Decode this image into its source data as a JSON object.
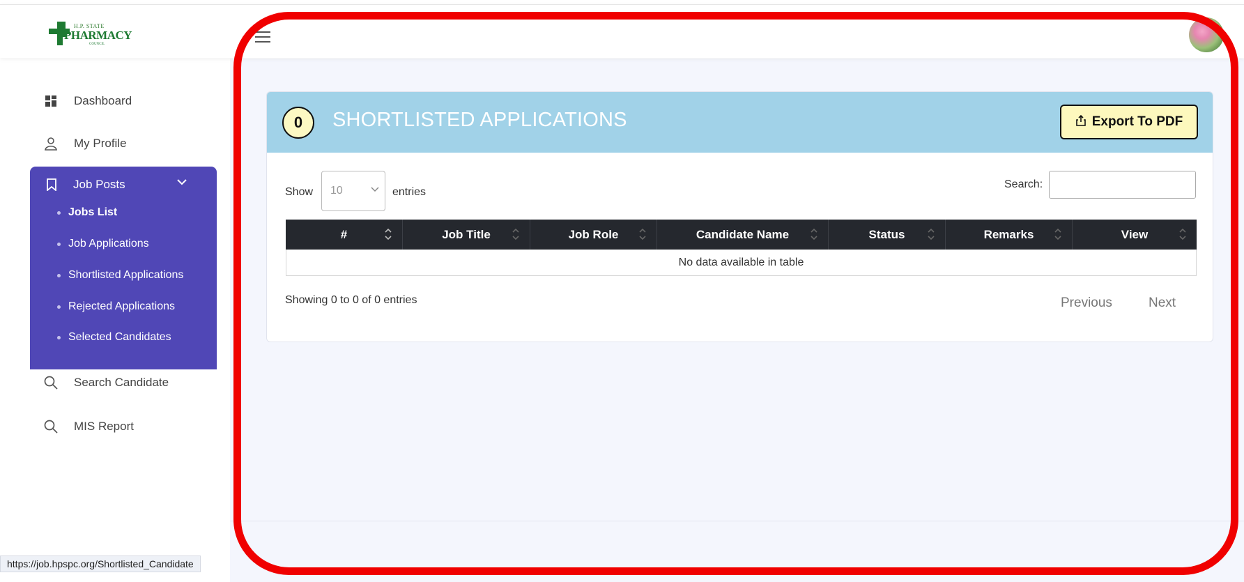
{
  "brand": {
    "logo_sub": "H.P. STATE",
    "logo_main": "PHARMACY",
    "logo_council": "COUNCIL"
  },
  "sidebar": {
    "items": [
      {
        "label": "Dashboard",
        "icon": "dashboard-icon"
      },
      {
        "label": "My Profile",
        "icon": "user-icon"
      }
    ],
    "job_posts": {
      "label": "Job Posts",
      "icon": "bookmark-icon",
      "expanded": true,
      "subitems": [
        {
          "label": "Jobs List"
        },
        {
          "label": "Job Applications"
        },
        {
          "label": "Shortlisted Applications"
        },
        {
          "label": "Rejected Applications"
        },
        {
          "label": "Selected Candidates"
        }
      ]
    },
    "bottom_items": [
      {
        "label": "Search Candidate",
        "icon": "search-icon"
      },
      {
        "label": "MIS Report",
        "icon": "search-icon"
      }
    ]
  },
  "card": {
    "count": "0",
    "title": "SHORTLISTED APPLICATIONS",
    "export_label": "Export To PDF"
  },
  "table_controls": {
    "show_label": "Show",
    "entries_value": "10",
    "entries_label": "entries",
    "search_label": "Search:",
    "search_value": ""
  },
  "table": {
    "columns": [
      "#",
      "Job Title",
      "Job Role",
      "Candidate Name",
      "Status",
      "Remarks",
      "View"
    ],
    "empty_message": "No data available in table"
  },
  "pagination": {
    "info": "Showing 0 to 0 of 0 entries",
    "previous": "Previous",
    "next": "Next"
  },
  "status_bar": {
    "url": "https://job.hpspc.org/Shortlisted_Candidate"
  },
  "colors": {
    "accent_purple": "#5047b6",
    "header_blue": "#a1d2e8",
    "badge_yellow": "#fdf8bd",
    "highlight_red": "#f00000"
  }
}
